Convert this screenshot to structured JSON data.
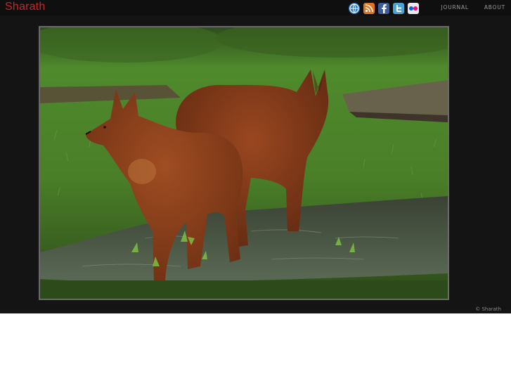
{
  "header": {
    "logo": "Sharath",
    "social_icons": [
      {
        "name": "website-icon",
        "color": "#2b7bc4"
      },
      {
        "name": "rss-icon",
        "color": "#e0731c"
      },
      {
        "name": "facebook-icon",
        "color": "#3b5b9a"
      },
      {
        "name": "twitter-icon",
        "color": "#4aa3d6"
      },
      {
        "name": "flickr-icon",
        "color": "#e9e9e9"
      }
    ],
    "nav": [
      "JOURNAL",
      "ABOUT"
    ]
  },
  "photo": {
    "subject": "Two dholes standing in a puddle on green grass",
    "colors": {
      "grass": "#4e7f2a",
      "fur": "#8a3f1c",
      "water": "#3d4a3a"
    }
  },
  "footer": {
    "copyright": "© Sharath"
  }
}
